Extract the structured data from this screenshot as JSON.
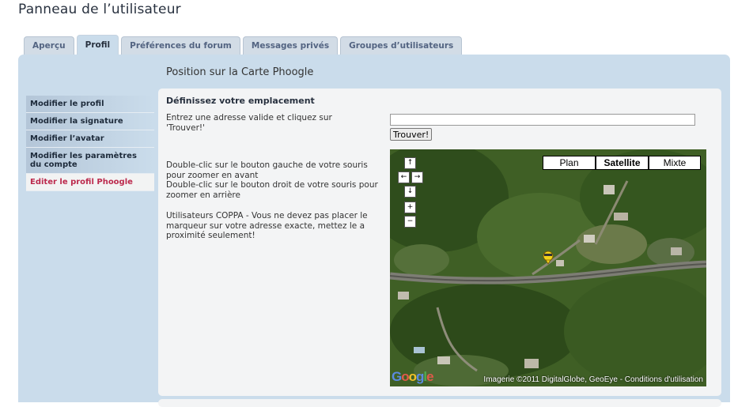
{
  "page": {
    "title": "Panneau de l’utilisateur"
  },
  "tabs": [
    {
      "label": "Aperçu",
      "active": false
    },
    {
      "label": "Profil",
      "active": true
    },
    {
      "label": "Préférences du forum",
      "active": false
    },
    {
      "label": "Messages privés",
      "active": false
    },
    {
      "label": "Groupes d’utilisateurs",
      "active": false
    }
  ],
  "section": {
    "title": "Position sur la Carte Phoogle"
  },
  "menu": [
    {
      "label": "Modifier le profil",
      "active": false
    },
    {
      "label": "Modifier la signature",
      "active": false
    },
    {
      "label": "Modifier l’avatar",
      "active": false
    },
    {
      "label": "Modifier les paramètres du compte",
      "active": false
    },
    {
      "label": "Editer le profil Phoogle",
      "active": true
    }
  ],
  "content": {
    "heading": "Définissez votre emplacement",
    "instructions": "Entrez une adresse valide et cliquez sur 'Trouver!'",
    "zoom_help_1": "Double-clic sur le bouton gauche de votre souris pour zoomer en avant",
    "zoom_help_2": "Double-clic sur le bouton droit de votre souris pour zoomer en arrière",
    "coppa_note": "Utilisateurs COPPA - Vous ne devez pas placer le marqueur sur votre adresse exacte, mettez le a proximité seulement!",
    "address_value": "",
    "find_button": "Trouver!"
  },
  "map": {
    "types": [
      {
        "label": "Plan",
        "active": false
      },
      {
        "label": "Satellite",
        "active": true
      },
      {
        "label": "Mixte",
        "active": false
      }
    ],
    "nav": {
      "up": "↑",
      "left": "←",
      "right": "→",
      "down": "↓",
      "zoom_in": "+",
      "zoom_out": "−"
    },
    "attribution": "Imagerie ©2011 DigitalGlobe, GeoEye - Conditions d'utilisation",
    "logo": "Google"
  }
}
